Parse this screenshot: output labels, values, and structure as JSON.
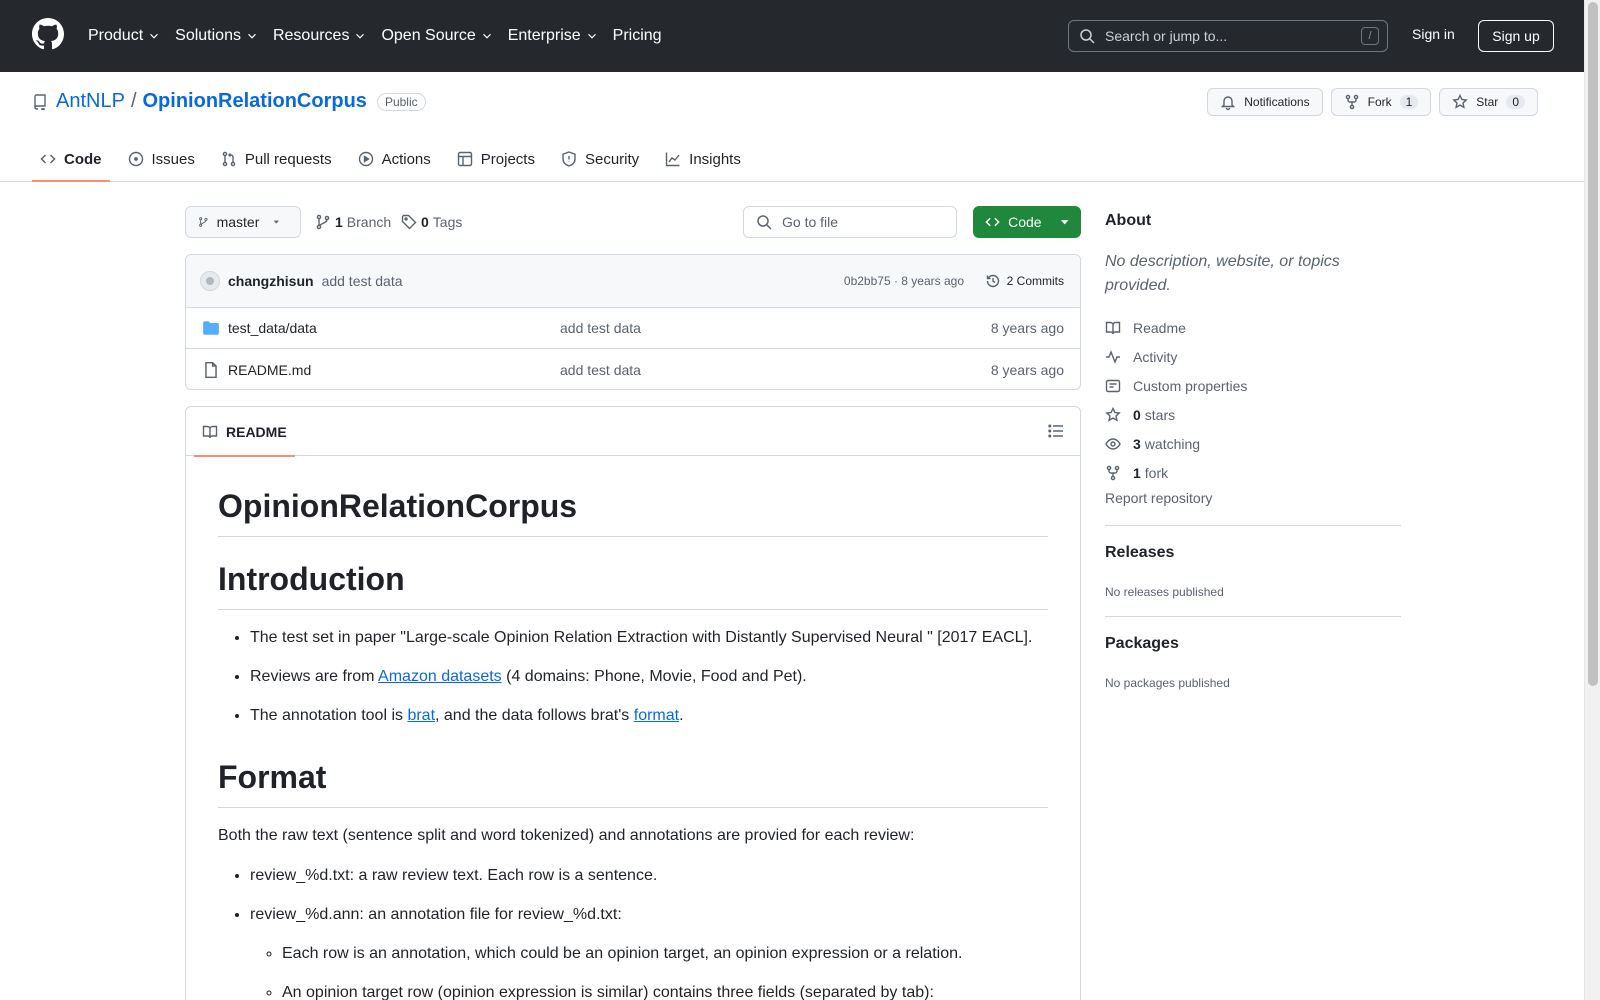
{
  "header": {
    "nav": [
      "Product",
      "Solutions",
      "Resources",
      "Open Source",
      "Enterprise",
      "Pricing"
    ],
    "search_placeholder": "Search or jump to...",
    "search_shortcut": "/",
    "sign_in": "Sign in",
    "sign_up": "Sign up"
  },
  "repo": {
    "owner": "AntNLP",
    "separator": "/",
    "name": "OpinionRelationCorpus",
    "visibility": "Public",
    "actions": {
      "notifications": "Notifications",
      "fork": "Fork",
      "fork_count": "1",
      "star": "Star",
      "star_count": "0"
    },
    "tabs": [
      "Code",
      "Issues",
      "Pull requests",
      "Actions",
      "Projects",
      "Security",
      "Insights"
    ]
  },
  "toolbar": {
    "branch": "master",
    "branch_count": "1",
    "branch_label": "Branch",
    "tag_count": "0",
    "tag_label": "Tags",
    "goto_placeholder": "Go to file",
    "code_button": "Code"
  },
  "commit": {
    "author": "changzhisun",
    "message": "add test data",
    "hash_time": "0b2bb75 · 8 years ago",
    "commits": "2 Commits"
  },
  "files": [
    {
      "name": "test_data/data",
      "type": "folder",
      "message": "add test data",
      "age": "8 years ago"
    },
    {
      "name": "README.md",
      "type": "file",
      "message": "add test data",
      "age": "8 years ago"
    }
  ],
  "readme": {
    "tab": "README",
    "title": "OpinionRelationCorpus",
    "intro_heading": "Introduction",
    "intro_1": "The test set in paper \"Large-scale Opinion Relation Extraction with Distantly Supervised Neural \" [2017 EACL].",
    "intro_2_pre": "Reviews are from ",
    "intro_2_link": "Amazon datasets",
    "intro_2_post": " (4 domains: Phone, Movie, Food and Pet).",
    "intro_3_pre": "The annotation tool is ",
    "intro_3_link1": "brat",
    "intro_3_mid": ", and the data follows brat's ",
    "intro_3_link2": "format",
    "intro_3_post": ".",
    "format_heading": "Format",
    "format_para": "Both the raw text (sentence split and word tokenized) and annotations are provied for each review:",
    "format_1": "review_%d.txt: a raw review text. Each row is a sentence.",
    "format_2": "review_%d.ann: an annotation file for review_%d.txt:",
    "format_2a": "Each row is an annotation, which could be an opinion target, an opinion expression or a relation.",
    "format_2b": "An opinion target row (opinion expression is similar) contains three fields (separated by tab):"
  },
  "sidebar": {
    "about": "About",
    "description": "No description, website, or topics provided.",
    "readme": "Readme",
    "activity": "Activity",
    "custom_properties": "Custom properties",
    "stars_count": "0",
    "stars_label": "stars",
    "watching_count": "3",
    "watching_label": "watching",
    "fork_count": "1",
    "fork_label": "fork",
    "report": "Report repository",
    "releases": "Releases",
    "no_releases": "No releases published",
    "packages": "Packages",
    "no_packages": "No packages published"
  },
  "colors": {
    "header_bg": "#25292e",
    "link": "#0969da",
    "code_button": "#1f883d",
    "tab_underline": "#fd8c73",
    "folder": "#54aeff"
  },
  "icons": [
    "github-logo-icon",
    "chevron-down-icon",
    "search-icon",
    "repo-icon",
    "bell-icon",
    "fork-icon",
    "star-icon",
    "code-icon",
    "issue-icon",
    "pull-request-icon",
    "actions-play-icon",
    "table-icon",
    "shield-icon",
    "graph-icon",
    "branch-icon",
    "tag-icon",
    "history-icon",
    "folder-icon",
    "file-icon",
    "book-icon",
    "list-icon",
    "pulse-icon",
    "note-icon",
    "eye-icon"
  ]
}
